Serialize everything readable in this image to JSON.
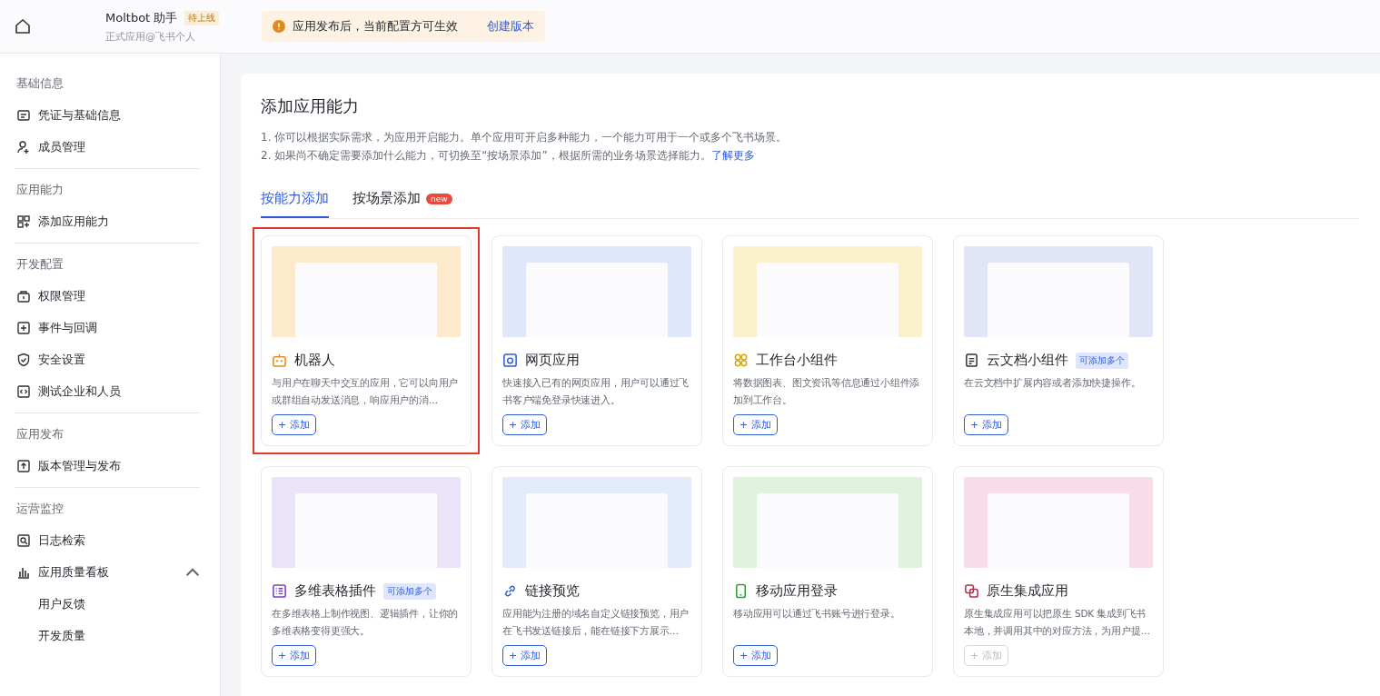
{
  "header": {
    "app_name": "Moltbot 助手",
    "status_badge": "待上线",
    "subtitle": "正式应用@飞书个人",
    "notice": {
      "text": "应用发布后，当前配置方可生效",
      "link": "创建版本"
    }
  },
  "sidebar": {
    "sections": [
      {
        "title": "基础信息",
        "items": [
          {
            "label": "凭证与基础信息"
          },
          {
            "label": "成员管理"
          }
        ]
      },
      {
        "title": "应用能力",
        "items": [
          {
            "label": "添加应用能力"
          }
        ]
      },
      {
        "title": "开发配置",
        "items": [
          {
            "label": "权限管理"
          },
          {
            "label": "事件与回调"
          },
          {
            "label": "安全设置"
          },
          {
            "label": "测试企业和人员"
          }
        ]
      },
      {
        "title": "应用发布",
        "items": [
          {
            "label": "版本管理与发布"
          }
        ]
      },
      {
        "title": "运营监控",
        "items": [
          {
            "label": "日志检索"
          },
          {
            "label": "应用质量看板",
            "expanded": true,
            "children": [
              {
                "label": "用户反馈"
              },
              {
                "label": "开发质量"
              }
            ]
          }
        ]
      }
    ]
  },
  "main": {
    "title": "添加应用能力",
    "notes": [
      "1. 你可以根据实际需求，为应用开启能力。单个应用可开启多种能力，一个能力可用于一个或多个飞书场景。",
      "2. 如果尚不确定需要添加什么能力，可切换至“按场景添加”，根据所需的业务场景选择能力。"
    ],
    "notes_link": "了解更多",
    "tabs": [
      {
        "label": "按能力添加",
        "selected": true
      },
      {
        "label": "按场景添加",
        "badge": "new",
        "selected": false
      }
    ],
    "cards": [
      {
        "title": "机器人",
        "description": "与用户在聊天中交互的应用，它可以向用户或群组自动发送消息，响应用户的消…",
        "button": "+ 添加",
        "disabled": false,
        "highlighted": true
      },
      {
        "title": "网页应用",
        "description": "快速接入已有的网页应用，用户可以通过飞书客户端免登录快速进入。",
        "button": "+ 添加",
        "disabled": false,
        "highlighted": false
      },
      {
        "title": "工作台小组件",
        "description": "将数据图表、图文资讯等信息通过小组件添加到工作台。",
        "button": "+ 添加",
        "disabled": false,
        "highlighted": false
      },
      {
        "title": "云文档小组件",
        "tag": "可添加多个",
        "description": "在云文档中扩展内容或者添加快捷操作。",
        "button": "+ 添加",
        "disabled": false,
        "highlighted": false
      },
      {
        "title": "多维表格插件",
        "tag": "可添加多个",
        "description": "在多维表格上制作视图、逻辑插件，让你的多维表格变得更强大。",
        "button": "+ 添加",
        "disabled": false,
        "highlighted": false
      },
      {
        "title": "链接预览",
        "description": "应用能为注册的域名自定义链接预览，用户在飞书发送链接后，能在链接下方展示…",
        "button": "+ 添加",
        "disabled": false,
        "highlighted": false
      },
      {
        "title": "移动应用登录",
        "description": "移动应用可以通过飞书账号进行登录。",
        "button": "+ 添加",
        "disabled": false,
        "highlighted": false
      },
      {
        "title": "原生集成应用",
        "description": "原生集成应用可以把原生 SDK 集成到飞书本地，并调用其中的对应方法，为用户提…",
        "button": "+ 添加",
        "disabled": true,
        "highlighted": false
      }
    ]
  }
}
